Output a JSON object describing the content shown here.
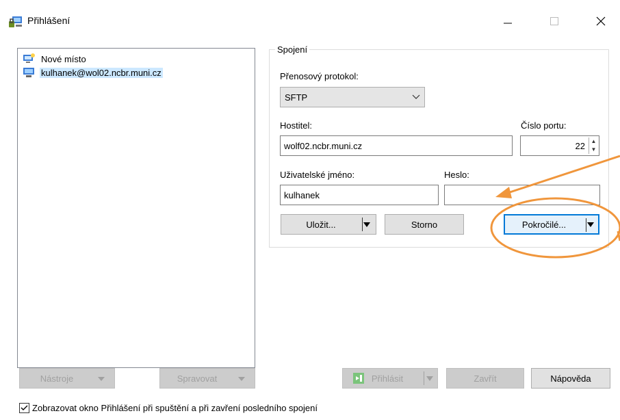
{
  "window": {
    "title": "Přihlášení",
    "minimize_icon": "minimize-icon",
    "maximize_icon": "maximize-icon",
    "close_icon": "close-icon"
  },
  "tree": {
    "items": [
      {
        "label": "Nové místo",
        "icon": "new-site-icon",
        "selected": false
      },
      {
        "label": "kulhanek@wol02.ncbr.muni.cz",
        "icon": "computer-icon",
        "selected": true
      }
    ]
  },
  "connection": {
    "group_label": "Spojení",
    "protocol_label": "Přenosový protokol:",
    "protocol_value": "SFTP",
    "host_label": "Hostitel:",
    "host_value": "wolf02.ncbr.muni.cz",
    "port_label": "Číslo portu:",
    "port_value": "22",
    "user_label": "Uživatelské jméno:",
    "user_value": "kulhanek",
    "password_label": "Heslo:",
    "password_value": "",
    "save_label": "Uložit...",
    "cancel_label": "Storno",
    "advanced_label": "Pokročilé..."
  },
  "bottom": {
    "tools_label": "Nástroje",
    "manage_label": "Spravovat",
    "login_label": "Přihlásit",
    "close_label": "Zavřít",
    "help_label": "Nápověda"
  },
  "checkbox": {
    "label": "Zobrazovat okno Přihlášení při spuštění a při zavření posledního spojení",
    "checked": true
  },
  "colors": {
    "annotation": "#f0963c",
    "focus": "#0078d7",
    "selection": "#cce8ff"
  }
}
